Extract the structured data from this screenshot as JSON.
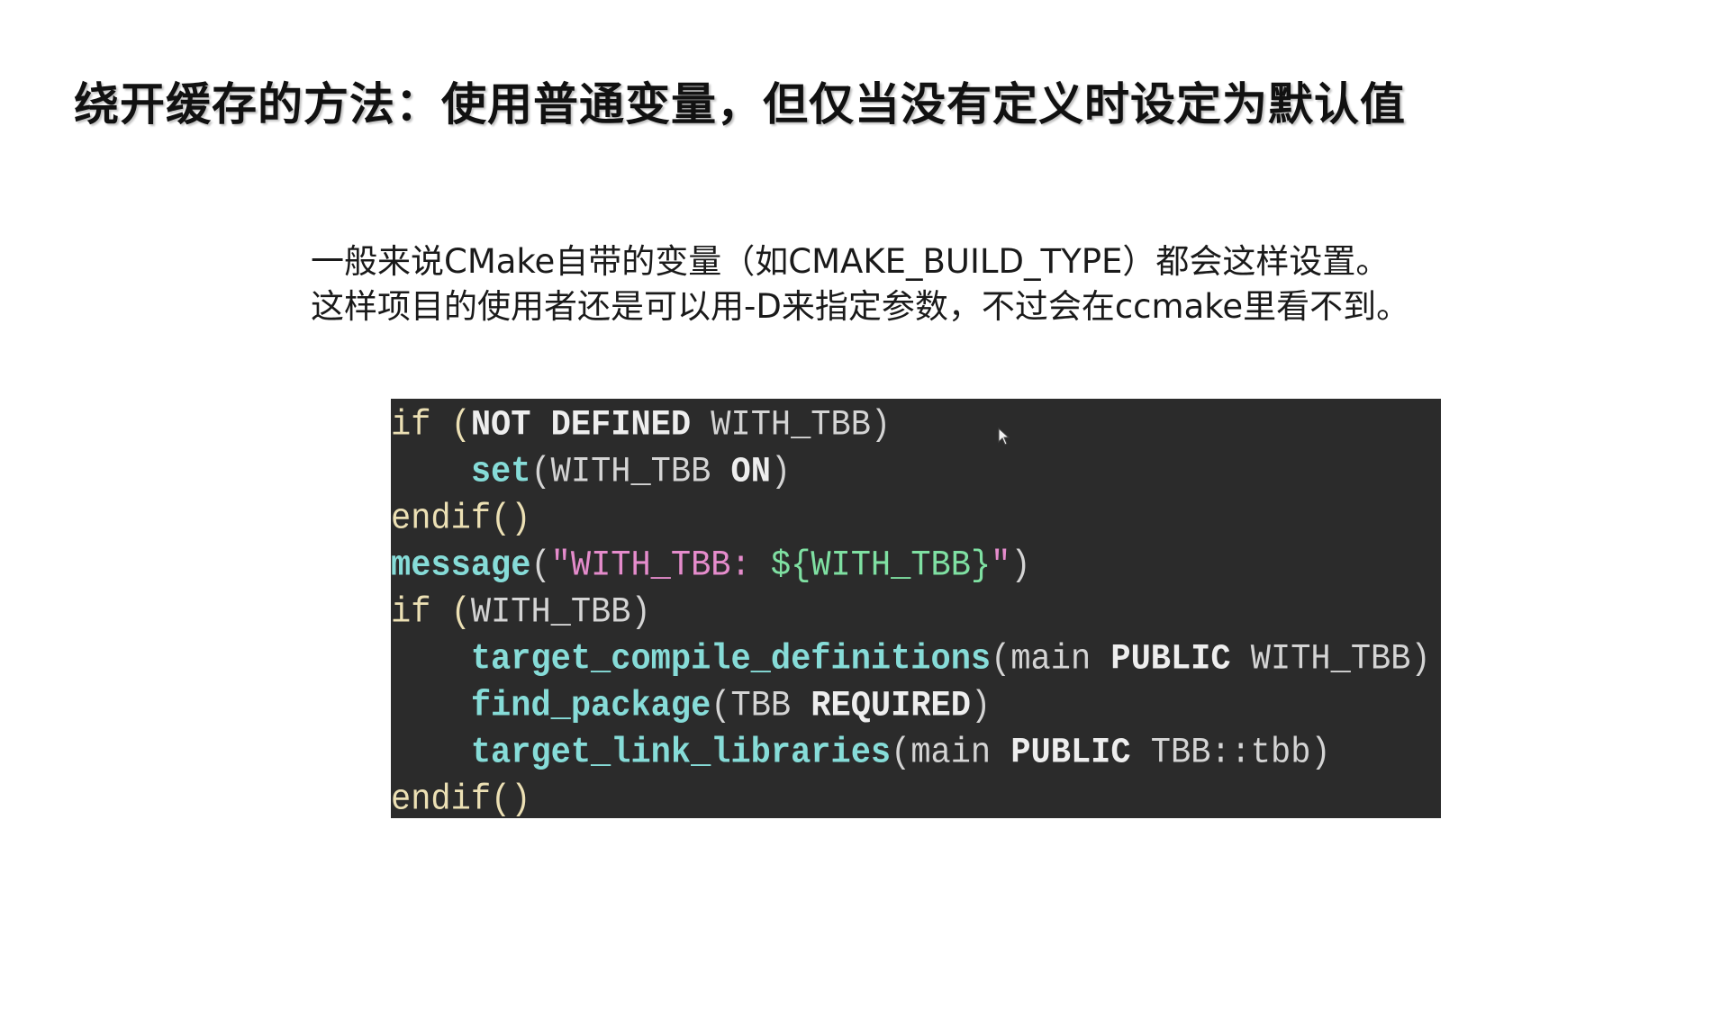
{
  "slide": {
    "title": "绕开缓存的方法：使用普通变量，但仅当没有定义时设定为默认值",
    "description": [
      "一般来说CMake自带的变量（如CMAKE_BUILD_TYPE）都会这样设置。",
      "这样项目的使用者还是可以用-D来指定参数，不过会在ccmake里看不到。"
    ]
  },
  "code": {
    "background": "#2b2b2b",
    "lines": [
      [
        [
          "if (",
          "kw"
        ],
        [
          "NOT DEFINED",
          "bold"
        ],
        [
          " WITH_TBB)",
          "txt"
        ]
      ],
      [
        [
          "    ",
          "txt"
        ],
        [
          "set",
          "fn"
        ],
        [
          "(WITH_TBB ",
          "txt"
        ],
        [
          "ON",
          "bold"
        ],
        [
          ")",
          "txt"
        ]
      ],
      [
        [
          "endif()",
          "kw"
        ]
      ],
      [
        [
          "message",
          "fn"
        ],
        [
          "(",
          "txt"
        ],
        [
          "\"WITH_TBB: ",
          "str"
        ],
        [
          "${WITH_TBB}",
          "var"
        ],
        [
          "\"",
          "str"
        ],
        [
          ")",
          "txt"
        ]
      ],
      [
        [
          "if (",
          "kw"
        ],
        [
          "WITH_TBB)",
          "txt"
        ]
      ],
      [
        [
          "    ",
          "txt"
        ],
        [
          "target_compile_definitions",
          "fn"
        ],
        [
          "(main ",
          "txt"
        ],
        [
          "PUBLIC",
          "bold"
        ],
        [
          " WITH_TBB)",
          "txt"
        ]
      ],
      [
        [
          "    ",
          "txt"
        ],
        [
          "find_package",
          "fn"
        ],
        [
          "(TBB ",
          "txt"
        ],
        [
          "REQUIRED",
          "bold"
        ],
        [
          ")",
          "txt"
        ]
      ],
      [
        [
          "    ",
          "txt"
        ],
        [
          "target_link_libraries",
          "fn"
        ],
        [
          "(main ",
          "txt"
        ],
        [
          "PUBLIC",
          "bold"
        ],
        [
          " TBB::tbb)",
          "txt"
        ]
      ],
      [
        [
          "endif()",
          "kw"
        ]
      ]
    ]
  },
  "icons": {
    "cursor": "mouse-pointer-icon"
  }
}
